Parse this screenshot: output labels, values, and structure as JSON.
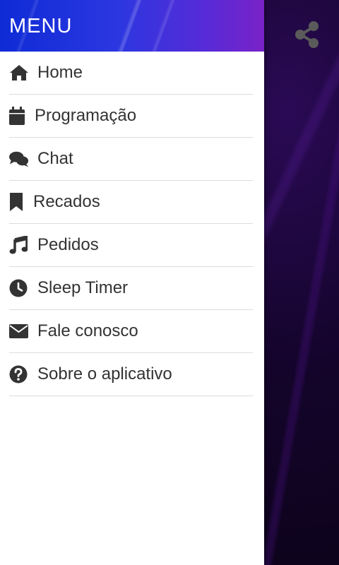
{
  "drawer": {
    "title": "MENU",
    "items": [
      {
        "label": "Home",
        "icon": "home-icon"
      },
      {
        "label": "Programação",
        "icon": "calendar-icon"
      },
      {
        "label": "Chat",
        "icon": "chat-icon"
      },
      {
        "label": "Recados",
        "icon": "bookmark-icon"
      },
      {
        "label": "Pedidos",
        "icon": "music-note-icon"
      },
      {
        "label": "Sleep Timer",
        "icon": "clock-icon"
      },
      {
        "label": "Fale conosco",
        "icon": "envelope-icon"
      },
      {
        "label": "Sobre o aplicativo",
        "icon": "question-circle-icon"
      }
    ]
  },
  "background": {
    "share_icon": "share-icon"
  },
  "colors": {
    "header_start": "#0e2bd6",
    "header_end": "#7a22c8",
    "text": "#333333",
    "icon": "#333333",
    "divider": "#dcdcdc",
    "share_icon": "#5a5a5a"
  }
}
